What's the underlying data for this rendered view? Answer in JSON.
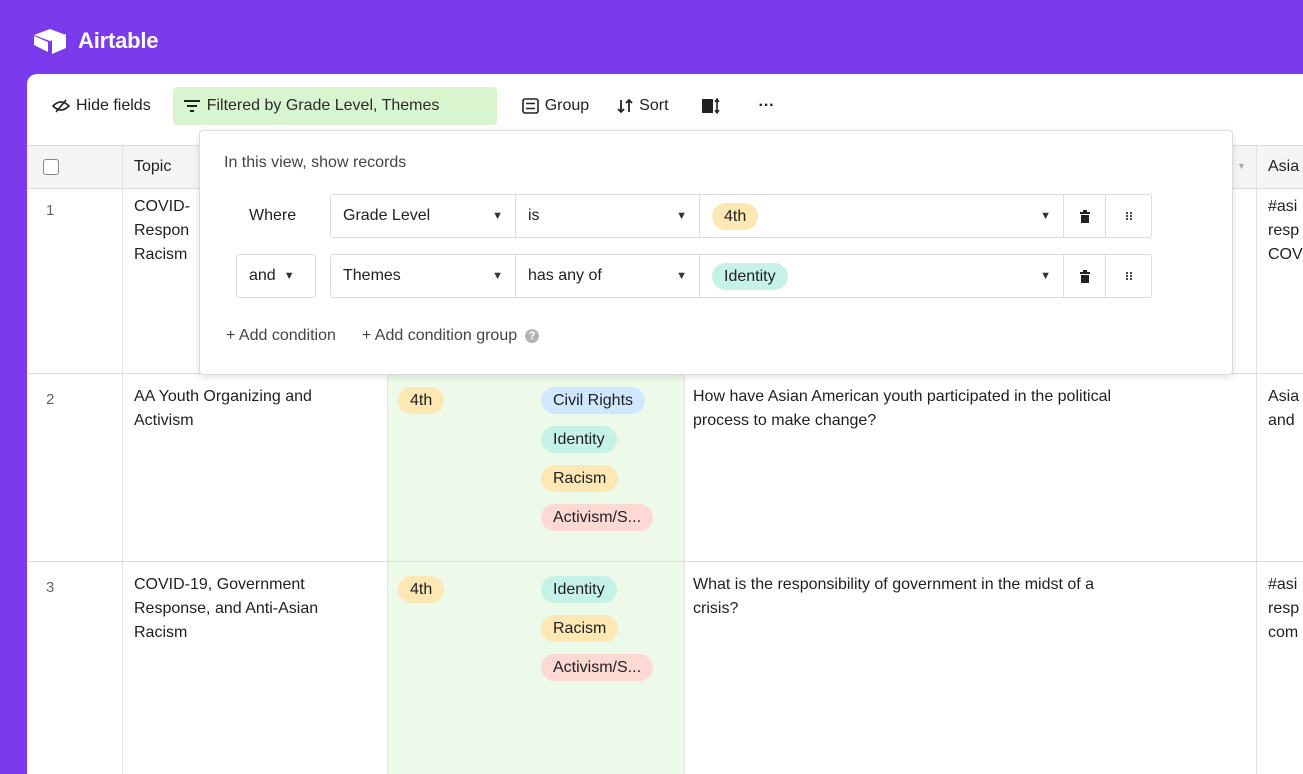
{
  "app": {
    "name": "Airtable"
  },
  "toolbar": {
    "hide_fields": "Hide fields",
    "filter": "Filtered by Grade Level, Themes",
    "group": "Group",
    "sort": "Sort",
    "more": "···"
  },
  "columns": {
    "topic": "Topic",
    "last": "Asia"
  },
  "filter_popover": {
    "title": "In this view, show records",
    "conditions": [
      {
        "conjunction": "Where",
        "field": "Grade Level",
        "operator": "is",
        "value": "4th"
      },
      {
        "conjunction": "and",
        "field": "Themes",
        "operator": "has any of",
        "value": "Identity"
      }
    ],
    "add_condition": "+ Add condition",
    "add_condition_group": "+ Add condition group"
  },
  "rows": [
    {
      "num": "1",
      "topic": [
        "COVID-",
        "Respon",
        "Racism"
      ],
      "last": [
        "#asi",
        "resp",
        "COV"
      ]
    },
    {
      "num": "2",
      "topic": [
        "AA Youth Organizing and",
        "Activism"
      ],
      "grade": "4th",
      "themes": [
        "Civil Rights",
        "Identity",
        "Racism",
        "Activism/S..."
      ],
      "question": [
        "How have Asian American youth  participated in the political",
        "process to make change?"
      ],
      "last": [
        "Asia",
        "and"
      ]
    },
    {
      "num": "3",
      "topic": [
        "COVID-19, Government",
        "Response, and Anti-Asian",
        "Racism"
      ],
      "grade": "4th",
      "themes": [
        "Identity",
        "Racism",
        "Activism/S..."
      ],
      "question": [
        "What is the responsibility of government in the midst of a",
        "crisis?"
      ],
      "last": [
        "#asi",
        "resp",
        "com"
      ]
    }
  ],
  "colors": {
    "brand": "#7c3aed",
    "filter_bg": "#d9f5cf",
    "green_band": "#edfae9"
  }
}
